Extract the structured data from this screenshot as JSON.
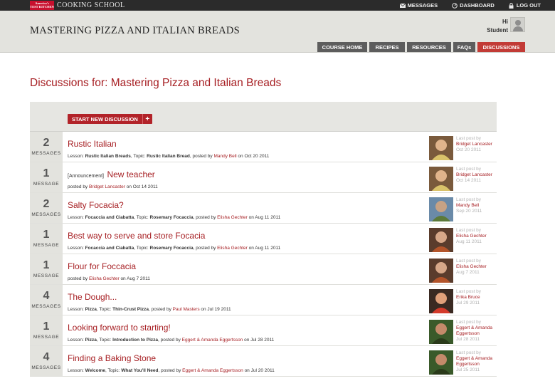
{
  "topbar": {
    "logo_line1": "America's",
    "logo_line2": "TEST KITCHEN",
    "school_name": "COOKING SCHOOL",
    "nav": [
      {
        "label": "MESSAGES",
        "icon": "envelope-icon"
      },
      {
        "label": "DASHBOARD",
        "icon": "dashboard-icon"
      },
      {
        "label": "LOG OUT",
        "icon": "lock-icon"
      }
    ]
  },
  "header": {
    "course_title": "MASTERING PIZZA AND ITALIAN BREADS",
    "greeting": "Hi",
    "user_name": "Student",
    "tabs": [
      {
        "label": "COURSE HOME",
        "active": false
      },
      {
        "label": "RECIPES",
        "active": false
      },
      {
        "label": "RESOURCES",
        "active": false
      },
      {
        "label": "FAQs",
        "active": false
      },
      {
        "label": "DISCUSSIONS",
        "active": true
      }
    ]
  },
  "main": {
    "page_title": "Discussions for: Mastering Pizza and Italian Breads",
    "start_button": "START NEW DISCUSSION",
    "start_button_plus": "+",
    "last_post_label": "Last post by",
    "discussions": [
      {
        "count": "2",
        "count_label": "MESSAGES",
        "announcement": "",
        "title": "Rustic Italian",
        "meta": [
          {
            "t": "Lesson: "
          },
          {
            "t": "Rustic Italian Breads",
            "b": true
          },
          {
            "t": ", Topic: "
          },
          {
            "t": "Rustic Italian Bread",
            "b": true
          },
          {
            "t": ", posted by "
          },
          {
            "t": "Mandy Bell",
            "l": true
          },
          {
            "t": " on Oct 20 2011"
          }
        ],
        "last_by": "Bridget Lancaster",
        "last_date": "Oct 20 2011"
      },
      {
        "count": "1",
        "count_label": "MESSAGE",
        "announcement": "[Announcement]",
        "title": "New teacher",
        "meta": [
          {
            "t": "posted by "
          },
          {
            "t": "Bridget Lancaster",
            "l": true
          },
          {
            "t": " on Oct 14 2011"
          }
        ],
        "last_by": "Bridget Lancaster",
        "last_date": "Oct 14 2011"
      },
      {
        "count": "2",
        "count_label": "MESSAGES",
        "announcement": "",
        "title": "Salty Focacia?",
        "meta": [
          {
            "t": "Lesson: "
          },
          {
            "t": "Focaccia and Ciabatta",
            "b": true
          },
          {
            "t": ", Topic: "
          },
          {
            "t": "Rosemary Focaccia",
            "b": true
          },
          {
            "t": ", posted by "
          },
          {
            "t": "Elisha Gechter",
            "l": true
          },
          {
            "t": " on Aug 11 2011"
          }
        ],
        "last_by": "Mandy Bell",
        "last_date": "Sep 20 2011"
      },
      {
        "count": "1",
        "count_label": "MESSAGE",
        "announcement": "",
        "title": "Best way to serve and store Focacia",
        "meta": [
          {
            "t": "Lesson: "
          },
          {
            "t": "Focaccia and Ciabatta",
            "b": true
          },
          {
            "t": ", Topic: "
          },
          {
            "t": "Rosemary Focaccia",
            "b": true
          },
          {
            "t": ", posted by "
          },
          {
            "t": "Elisha Gechter",
            "l": true
          },
          {
            "t": " on Aug 11 2011"
          }
        ],
        "last_by": "Elisha Gechter",
        "last_date": "Aug 11 2011"
      },
      {
        "count": "1",
        "count_label": "MESSAGE",
        "announcement": "",
        "title": "Flour for Foccacia",
        "meta": [
          {
            "t": "posted by "
          },
          {
            "t": "Elisha Gechter",
            "l": true
          },
          {
            "t": " on Aug 7 2011"
          }
        ],
        "last_by": "Elisha Gechter",
        "last_date": "Aug 7 2011"
      },
      {
        "count": "4",
        "count_label": "MESSAGES",
        "announcement": "",
        "title": "The Dough...",
        "meta": [
          {
            "t": "Lesson: "
          },
          {
            "t": "Pizza",
            "b": true
          },
          {
            "t": ", Topic: "
          },
          {
            "t": "Thin-Crust Pizza",
            "b": true
          },
          {
            "t": ", posted by "
          },
          {
            "t": "Paul Masters",
            "l": true
          },
          {
            "t": " on Jul 19 2011"
          }
        ],
        "last_by": "Erika Bruce",
        "last_date": "Jul 29 2011"
      },
      {
        "count": "1",
        "count_label": "MESSAGE",
        "announcement": "",
        "title": "Looking forward to starting!",
        "meta": [
          {
            "t": "Lesson: "
          },
          {
            "t": "Pizza",
            "b": true
          },
          {
            "t": ", Topic: "
          },
          {
            "t": "Introduction to Pizza",
            "b": true
          },
          {
            "t": ", posted by "
          },
          {
            "t": "Eggert & Amanda Eggertsson",
            "l": true
          },
          {
            "t": " on Jul 28 2011"
          }
        ],
        "last_by": "Eggert & Amanda Eggertsson",
        "last_date": "Jul 28 2011"
      },
      {
        "count": "4",
        "count_label": "MESSAGES",
        "announcement": "",
        "title": "Finding a Baking Stone",
        "meta": [
          {
            "t": "Lesson: "
          },
          {
            "t": "Welcome",
            "b": true
          },
          {
            "t": ", Topic: "
          },
          {
            "t": "What You'll Need",
            "b": true
          },
          {
            "t": ", posted by "
          },
          {
            "t": "Eggert & Amanda Eggertsson",
            "l": true
          },
          {
            "t": " on Jul 20 2011"
          }
        ],
        "last_by": "Eggert & Amanda Eggertsson",
        "last_date": "Jul 25 2011"
      }
    ]
  },
  "colors": {
    "accent": "#a61e22",
    "active_tab": "#c23b36",
    "tab": "#5d5d5d",
    "header_bg": "#e3e3de",
    "topbar": "#2b2b2b"
  }
}
